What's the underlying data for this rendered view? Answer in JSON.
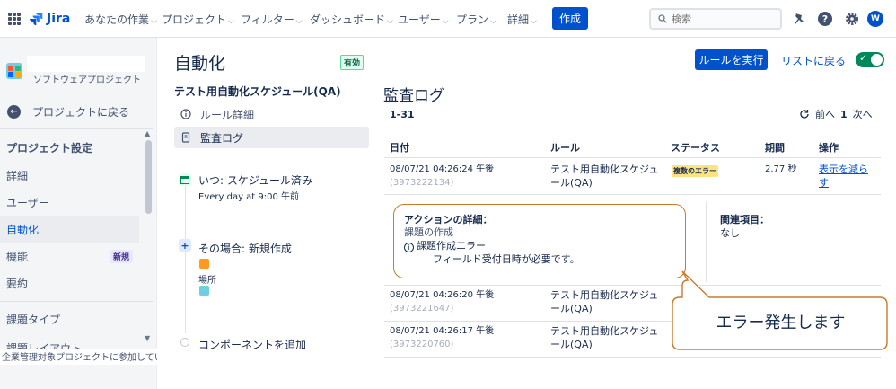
{
  "nav": {
    "logo": "Jira",
    "items": [
      "あなたの作業",
      "プロジェクト",
      "フィルター",
      "ダッシュボード",
      "ユーザー",
      "プラン",
      "詳細"
    ],
    "create": "作成",
    "search_placeholder": "検索",
    "avatar": "W"
  },
  "sidebar": {
    "project_name": "ソフトウェアプロジェクト",
    "back": "プロジェクトに戻る",
    "section": "プロジェクト設定",
    "items": [
      "詳細",
      "ユーザー",
      "自動化",
      "機能",
      "要約",
      "課題タイプ",
      "課題レイアウト"
    ],
    "active_item": "自動化",
    "badge": "新規",
    "footer": "企業管理対象プロジェクトに参加してい"
  },
  "header": {
    "title": "自動化",
    "status": "有効",
    "run_button": "ルールを実行",
    "back_to_list": "リストに戻る",
    "enabled": true,
    "brand_color": "#0052cc",
    "toggle_color": "#00875a"
  },
  "rule": {
    "name": "テスト用自動化スケジュール(QA)",
    "links": [
      "ルール詳細",
      "監査ログ"
    ],
    "trigger_title": "いつ: スケジュール済み",
    "trigger_sub": "Every day at 9:00 午前",
    "action_title": "その場合: 新規作成",
    "action_sub": "場所",
    "add_component": "コンポーネントを追加"
  },
  "audit": {
    "title": "監査ログ",
    "range": "1-31",
    "prev": "前へ",
    "page": "1",
    "next": "次へ",
    "columns": [
      "日付",
      "ルール",
      "ステータス",
      "期間",
      "操作"
    ],
    "rows": [
      {
        "date": "08/07/21 04:26:24 午後",
        "id": "(3973222134)",
        "rule_1": "テスト用自動化スケジュ",
        "rule_2": "ール(QA)",
        "status": "複数のエラー",
        "duration": "2.77 秒",
        "action_1": "表示を減ら",
        "action_2": "す"
      },
      {
        "date": "08/07/21 04:26:20 午後",
        "id": "(3973221647)",
        "rule_1": "テスト用自動化スケジュ",
        "rule_2": "ール(QA)"
      },
      {
        "date": "08/07/21 04:26:17 午後",
        "id": "(3973220760)",
        "rule_1": "テスト用自動化スケジュ",
        "rule_2": "ール(QA)"
      }
    ],
    "detail": {
      "title": "アクションの詳細：",
      "line1": "課題の作成",
      "line2": "課題作成エラー",
      "line3": "フィールド受付日時が必要です。",
      "related_head": "関連項目：",
      "related_val": "なし"
    }
  },
  "callout": {
    "text": "エラー発生します",
    "border_color": "#c97a2a"
  }
}
